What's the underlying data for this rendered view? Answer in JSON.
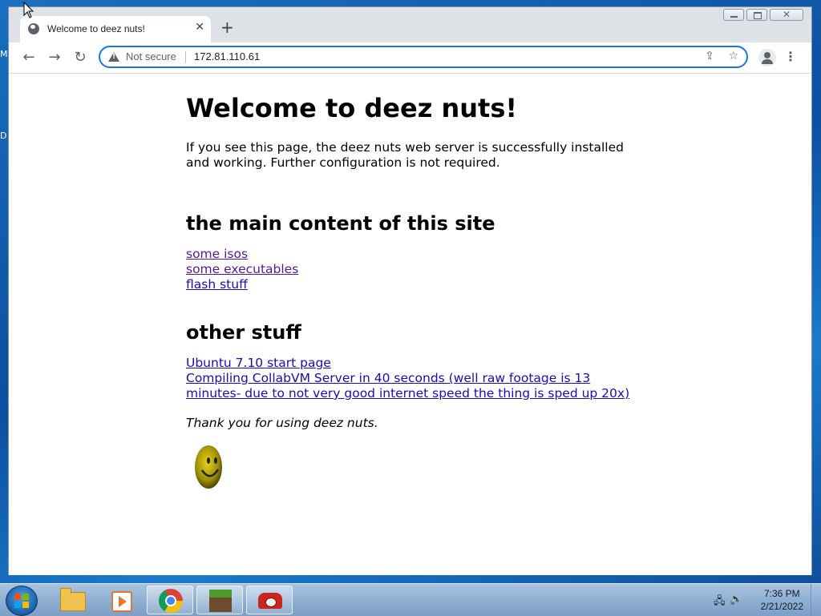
{
  "desktop": {
    "edge_letters": [
      "M",
      "D"
    ]
  },
  "browser": {
    "tab": {
      "title": "Welcome to deez nuts!",
      "close_icon": "close-icon",
      "favicon": "globe-icon"
    },
    "new_tab_label": "+",
    "address": {
      "security_label": "Not secure",
      "url": "172.81.110.61"
    }
  },
  "page": {
    "title": "Welcome to deez nuts!",
    "intro": "If you see this page, the deez nuts web server is successfully installed and working. Further configuration is not required.",
    "main_heading": "the main content of this site",
    "main_links": [
      "some isos",
      "some executables",
      "flash stuff"
    ],
    "other_heading": "other stuff",
    "other_links": [
      "Ubuntu 7.10 start page",
      "Compiling CollabVM Server in 40 seconds (well raw footage is 13 minutes- due to not very good internet speed the thing is sped up 20x)"
    ],
    "closing": "Thank you for using deez nuts."
  },
  "taskbar": {
    "apps": [
      "explorer",
      "media-player",
      "chrome",
      "minecraft",
      "phone"
    ],
    "clock": {
      "time": "7:36 PM",
      "date": "2/21/2022"
    }
  },
  "colors": {
    "link": "#1a0dab",
    "visited_link": "#551a8b",
    "omnibox_border": "#1a73e8"
  }
}
